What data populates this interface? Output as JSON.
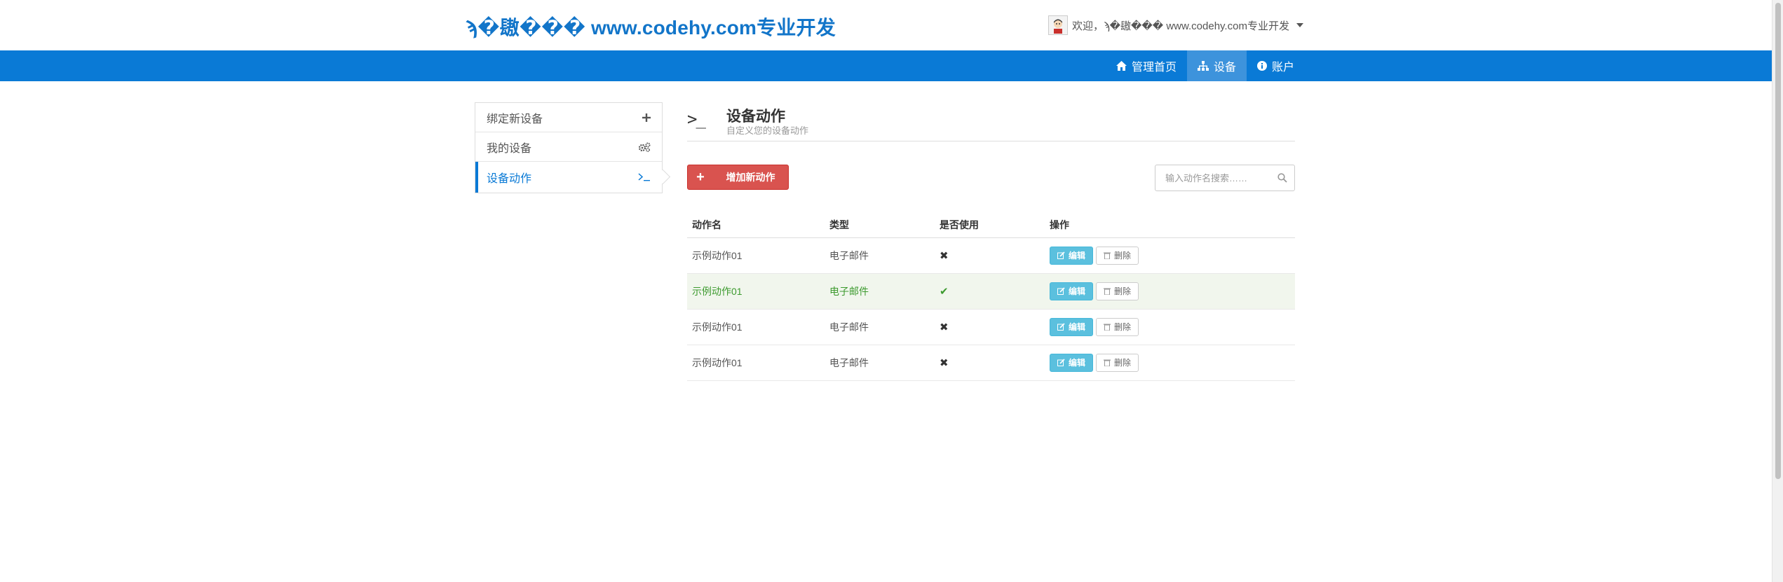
{
  "brand": {
    "title": "ϡ�䦋��� www.codehy.com专业开发"
  },
  "user_menu": {
    "greeting": "欢迎，ϡ�䦋��� www.codehy.com专业开发"
  },
  "nav": {
    "items": [
      {
        "label": "管理首页",
        "icon": "home-icon"
      },
      {
        "label": "设备",
        "icon": "sitemap-icon",
        "active": true
      },
      {
        "label": "账户",
        "icon": "info-circle-icon"
      }
    ]
  },
  "sidebar": {
    "items": [
      {
        "label": "绑定新设备",
        "icon": "plus-icon"
      },
      {
        "label": "我的设备",
        "icon": "cogs-icon"
      },
      {
        "label": "设备动作",
        "icon": "terminal-icon",
        "active": true
      }
    ]
  },
  "header": {
    "icon_text": ">_",
    "title": "设备动作",
    "subtitle": "自定义您的设备动作"
  },
  "toolbar": {
    "add_label": "增加新动作",
    "search_placeholder": "输入动作名搜索……"
  },
  "table": {
    "columns": [
      "动作名",
      "类型",
      "是否使用",
      "操作"
    ],
    "rows": [
      {
        "name": "示例动作01",
        "type": "电子邮件",
        "in_use": false,
        "edit": "编辑",
        "delete": "删除"
      },
      {
        "name": "示例动作01",
        "type": "电子邮件",
        "in_use": true,
        "edit": "编辑",
        "delete": "删除"
      },
      {
        "name": "示例动作01",
        "type": "电子邮件",
        "in_use": false,
        "edit": "编辑",
        "delete": "删除"
      },
      {
        "name": "示例动作01",
        "type": "电子邮件",
        "in_use": false,
        "edit": "编辑",
        "delete": "删除"
      }
    ]
  },
  "colors": {
    "primary": "#0a7ad6",
    "danger": "#d9534f",
    "info": "#5bc0de",
    "success": "#3c9a2e"
  }
}
